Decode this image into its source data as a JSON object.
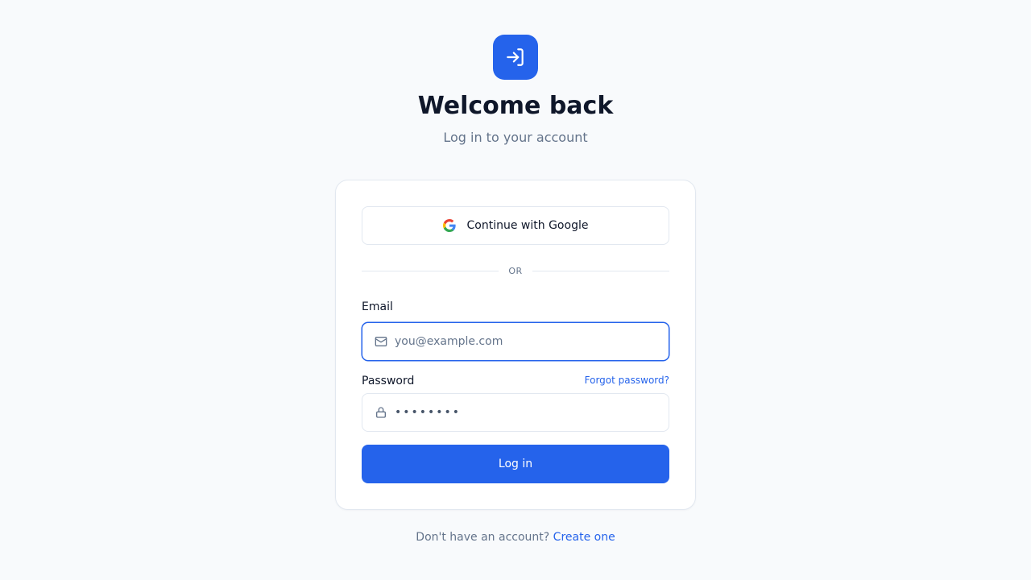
{
  "header": {
    "logo_icon": "login-arrow-icon",
    "title": "Welcome back",
    "subtitle": "Log in to your account"
  },
  "card": {
    "google_button": {
      "label": "Continue with Google",
      "icon": "google-icon"
    },
    "divider_text": "OR",
    "email": {
      "label": "Email",
      "placeholder": "you@example.com",
      "value": "",
      "icon": "mail-icon"
    },
    "password": {
      "label": "Password",
      "masked_value": "••••••••",
      "icon": "lock-icon",
      "forgot_link": "Forgot password?"
    },
    "login_button": "Log in"
  },
  "footer": {
    "prompt": "Don't have an account?",
    "link": "Create one"
  },
  "colors": {
    "accent": "#2563eb",
    "background": "#f8fafc",
    "heading": "#0f172a",
    "muted": "#64748b",
    "border": "#e2e8f0"
  }
}
